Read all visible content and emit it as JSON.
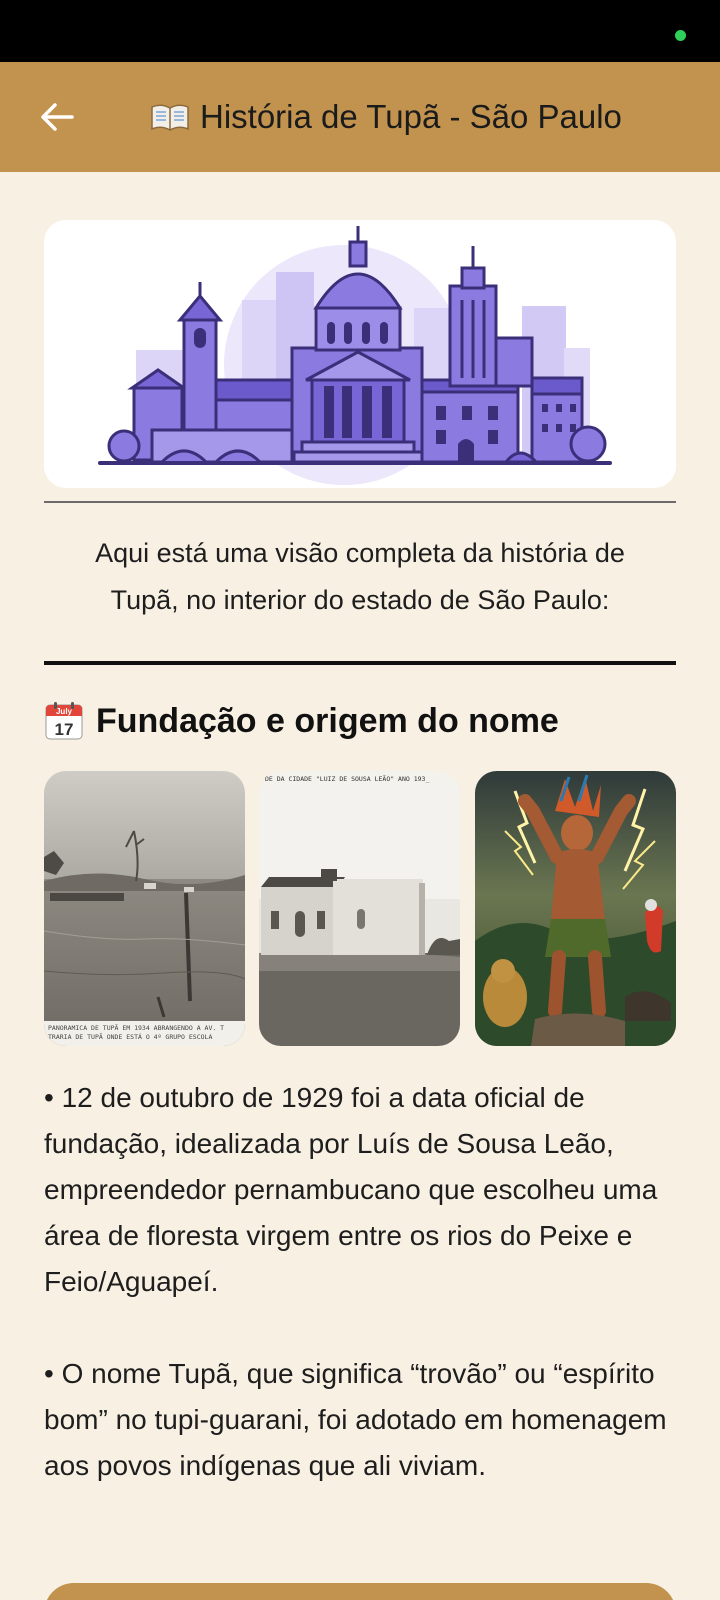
{
  "app_bar": {
    "title": "História de Tupã - São Paulo",
    "title_icon": "open-book-icon",
    "back_icon": "arrow-left-icon"
  },
  "hero": {
    "illustration": "city-skyline-illustration"
  },
  "intro": "Aqui está uma visão completa da história de Tupã, no interior do estado de São Paulo:",
  "section": {
    "icon": "calendar-icon",
    "calendar_month": "July",
    "calendar_day": "17",
    "title": "Fundação e origem do nome"
  },
  "photos": [
    {
      "caption_line1": "PANORAMICA DE TUPÃ EM 1934 ABRANGENDO A AV. T",
      "caption_line2": "TRARIA DE TUPÃ ONDE ESTÁ O 4º GRUPO ESCOLA"
    },
    {
      "header": "DE DA CIDADE \"LUIZ DE SOUSA LEÃO\"  ANO 193_"
    },
    {
      "alt": "tupa-deity-painting"
    }
  ],
  "paragraphs": [
    "• 12 de outubro de 1929 foi a data oficial de fundação, idealizada por Luís de Sousa Leão, empreendedor pernambucano que escolheu uma área de floresta virgem entre os rios do Peixe e Feio/Aguapeí.",
    "• O nome Tupã, que significa “trovão” ou “espírito bom” no tupi-guarani, foi adotado em homenagem aos povos indígenas que ali viviam."
  ],
  "colors": {
    "app_bar": "#c2934e",
    "background": "#f8f0e3",
    "accent_purple": "#7b68d9",
    "status_dot": "#2fd05a"
  }
}
